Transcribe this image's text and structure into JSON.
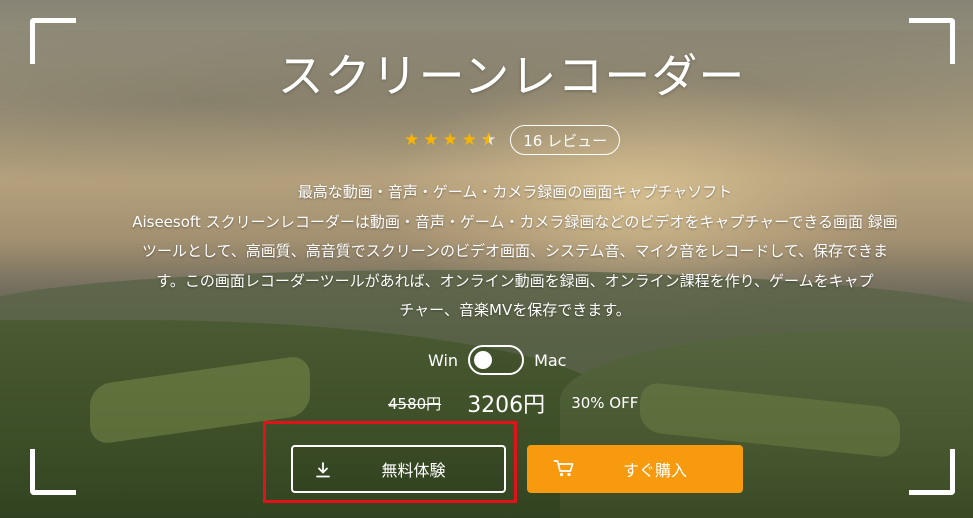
{
  "hero": {
    "title": "スクリーンレコーダー",
    "rating": {
      "stars": 4.5,
      "reviews_label": "16 レビュー"
    },
    "description_lines": [
      "最高な動画・音声・ゲーム・カメラ録画の画面キャプチャソフト",
      "Aiseesoft スクリーンレコーダーは動画・音声・ゲーム・カメラ録画などのビデオをキャプチャーできる画面 録画",
      "ツールとして、高画質、高音質でスクリーンのビデオ画面、システム音、マイク音をレコードして、保存できま",
      "す。この画面レコーダーツールがあれば、オンライン動画を録画、オンライン課程を作り、ゲームをキャプ",
      "チャー、音楽MVを保存できます。"
    ],
    "os_toggle": {
      "left_label": "Win",
      "right_label": "Mac",
      "selected": "Win"
    },
    "price": {
      "original": "4580円",
      "current": "3206円",
      "discount": "30% OFF"
    },
    "buttons": {
      "trial_label": "無料体験",
      "buy_label": "すぐ購入"
    },
    "colors": {
      "star": "#f7b500",
      "buy_button": "#f79a0e",
      "highlight_border": "#e0131b"
    }
  }
}
